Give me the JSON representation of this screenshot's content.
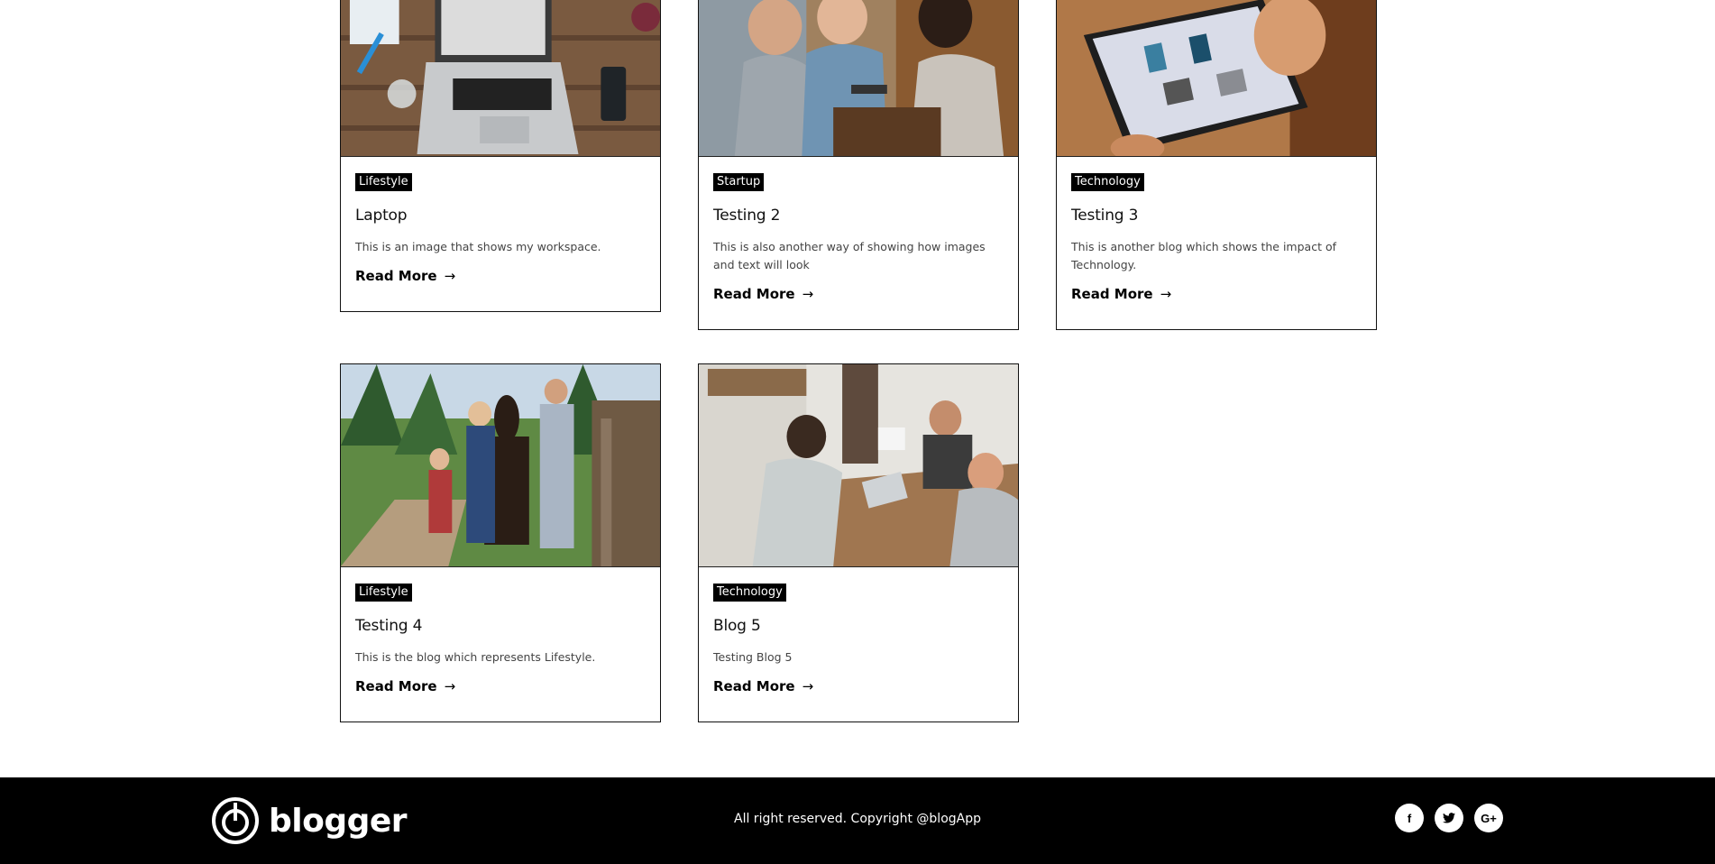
{
  "posts": [
    {
      "category": "Lifestyle",
      "title": "Laptop",
      "description": "This is an image that shows my workspace.",
      "read_more": "Read More",
      "image": "laptop-workspace-photo"
    },
    {
      "category": "Startup",
      "title": "Testing 2",
      "description": "This is also another way of showing how images and text will look",
      "read_more": "Read More",
      "image": "friends-cafe-photo"
    },
    {
      "category": "Technology",
      "title": "Testing 3",
      "description": "This is another blog which shows the impact of Technology.",
      "read_more": "Read More",
      "image": "tablet-photo"
    },
    {
      "category": "Lifestyle",
      "title": "Testing 4",
      "description": "This is the blog which represents Lifestyle.",
      "read_more": "Read More",
      "image": "family-horse-photo"
    },
    {
      "category": "Technology",
      "title": "Blog 5",
      "description": "Testing Blog 5",
      "read_more": "Read More",
      "image": "office-meeting-photo"
    }
  ],
  "footer": {
    "logo_text": "blogger",
    "copyright": "All right reserved. Copyright @blogApp",
    "socials": [
      {
        "icon": "facebook-icon",
        "glyph": "f"
      },
      {
        "icon": "twitter-icon",
        "glyph": "t"
      },
      {
        "icon": "google-plus-icon",
        "glyph": "G+"
      }
    ]
  },
  "colors": {
    "footer_bg": "#000000",
    "badge_bg": "#000000",
    "text": "#111111"
  }
}
